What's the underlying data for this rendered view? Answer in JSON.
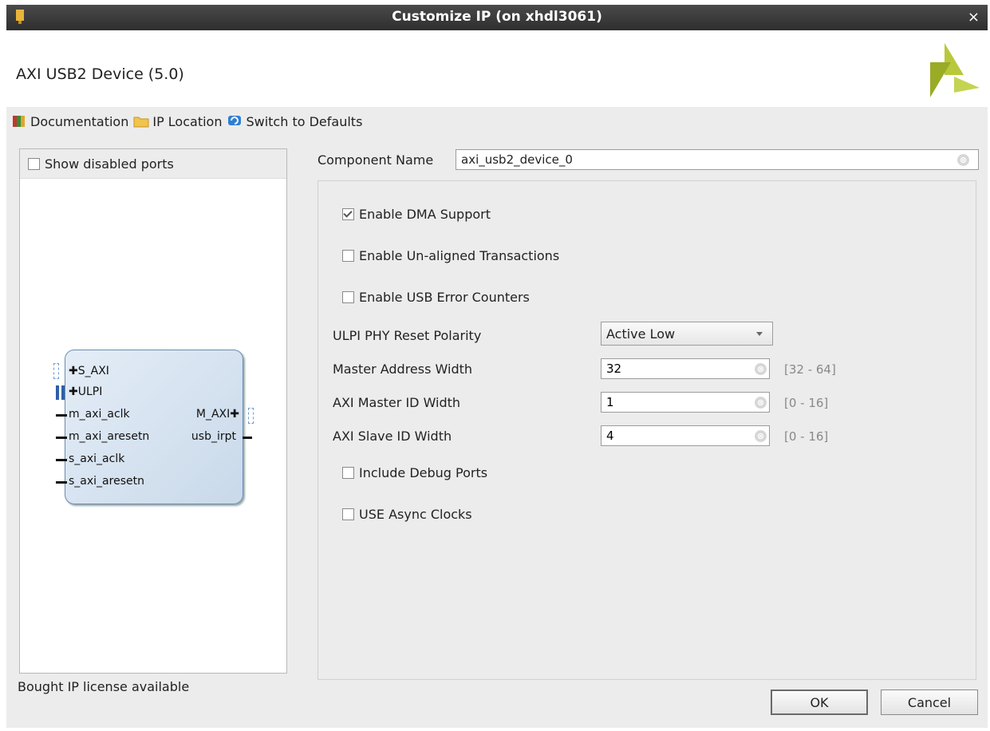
{
  "window": {
    "title": "Customize IP (on xhdl3061)",
    "close_glyph": "×"
  },
  "header": {
    "ip_title": "AXI USB2 Device (5.0)"
  },
  "toolbar": {
    "documentation": "Documentation",
    "ip_location": "IP Location",
    "switch_defaults": "Switch to Defaults"
  },
  "left_panel": {
    "show_disabled_ports": "Show disabled ports",
    "block": {
      "ports_left": [
        "S_AXI",
        "ULPI",
        "m_axi_aclk",
        "m_axi_aresetn",
        "s_axi_aclk",
        "s_axi_aresetn"
      ],
      "ports_right": [
        "M_AXI",
        "usb_irpt"
      ]
    }
  },
  "component": {
    "label": "Component Name",
    "value": "axi_usb2_device_0"
  },
  "options": {
    "enable_dma": "Enable DMA Support",
    "enable_unaligned": "Enable Un-aligned Transactions",
    "enable_usb_error": "Enable USB Error Counters",
    "include_debug": "Include Debug Ports",
    "use_async": "USE Async Clocks"
  },
  "params": {
    "ulpi_reset": {
      "label": "ULPI PHY Reset Polarity",
      "value": "Active Low"
    },
    "master_addr": {
      "label": "Master Address Width",
      "value": "32",
      "range": "[32 - 64]"
    },
    "master_id": {
      "label": "AXI Master ID Width",
      "value": "1",
      "range": "[0 - 16]"
    },
    "slave_id": {
      "label": "AXI Slave ID Width",
      "value": "4",
      "range": "[0 - 16]"
    }
  },
  "footer": {
    "status": "Bought IP license available",
    "ok": "OK",
    "cancel": "Cancel"
  },
  "icons": {
    "clear": "⊗",
    "plus": "✚"
  },
  "colors": {
    "title_bar": "#3a3a3a",
    "block_border": "#6a8db0",
    "logo": "#a9b92e"
  }
}
